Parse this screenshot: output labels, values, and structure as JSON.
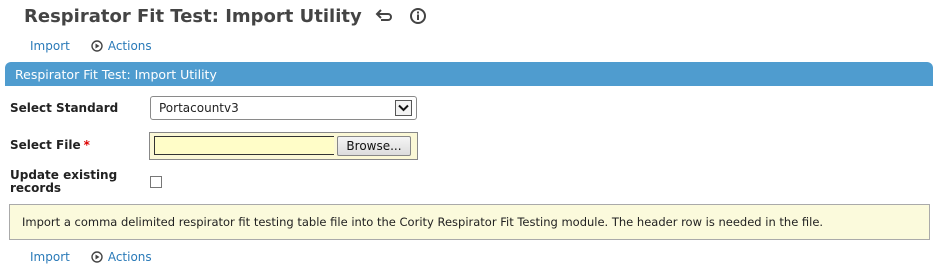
{
  "page": {
    "title": "Respirator Fit Test: Import Utility"
  },
  "toolbar": {
    "import_label": "Import",
    "actions_label": "Actions"
  },
  "panel": {
    "title": "Respirator Fit Test: Import Utility"
  },
  "form": {
    "standard_label": "Select Standard",
    "standard_value": "Portacountv3",
    "file_label": "Select File",
    "file_required_marker": "*",
    "file_value": "",
    "browse_label": "Browse...",
    "update_label_line1": "Update existing",
    "update_label_line2": "records",
    "update_checked": false
  },
  "info": {
    "message": "Import a comma delimited respirator fit testing table file into the Cority Respirator Fit Testing module. The header row is needed in the file."
  },
  "colors": {
    "accent": "#4f9ccf",
    "link": "#2a7ab8",
    "info_bg": "#fbfadc",
    "required": "#dd0000"
  },
  "icons": {
    "title_icons": [
      "return-arrow-icon",
      "info-circle-icon"
    ],
    "actions_icon": "play-circle-icon",
    "select_icon": "chevron-down-icon"
  }
}
